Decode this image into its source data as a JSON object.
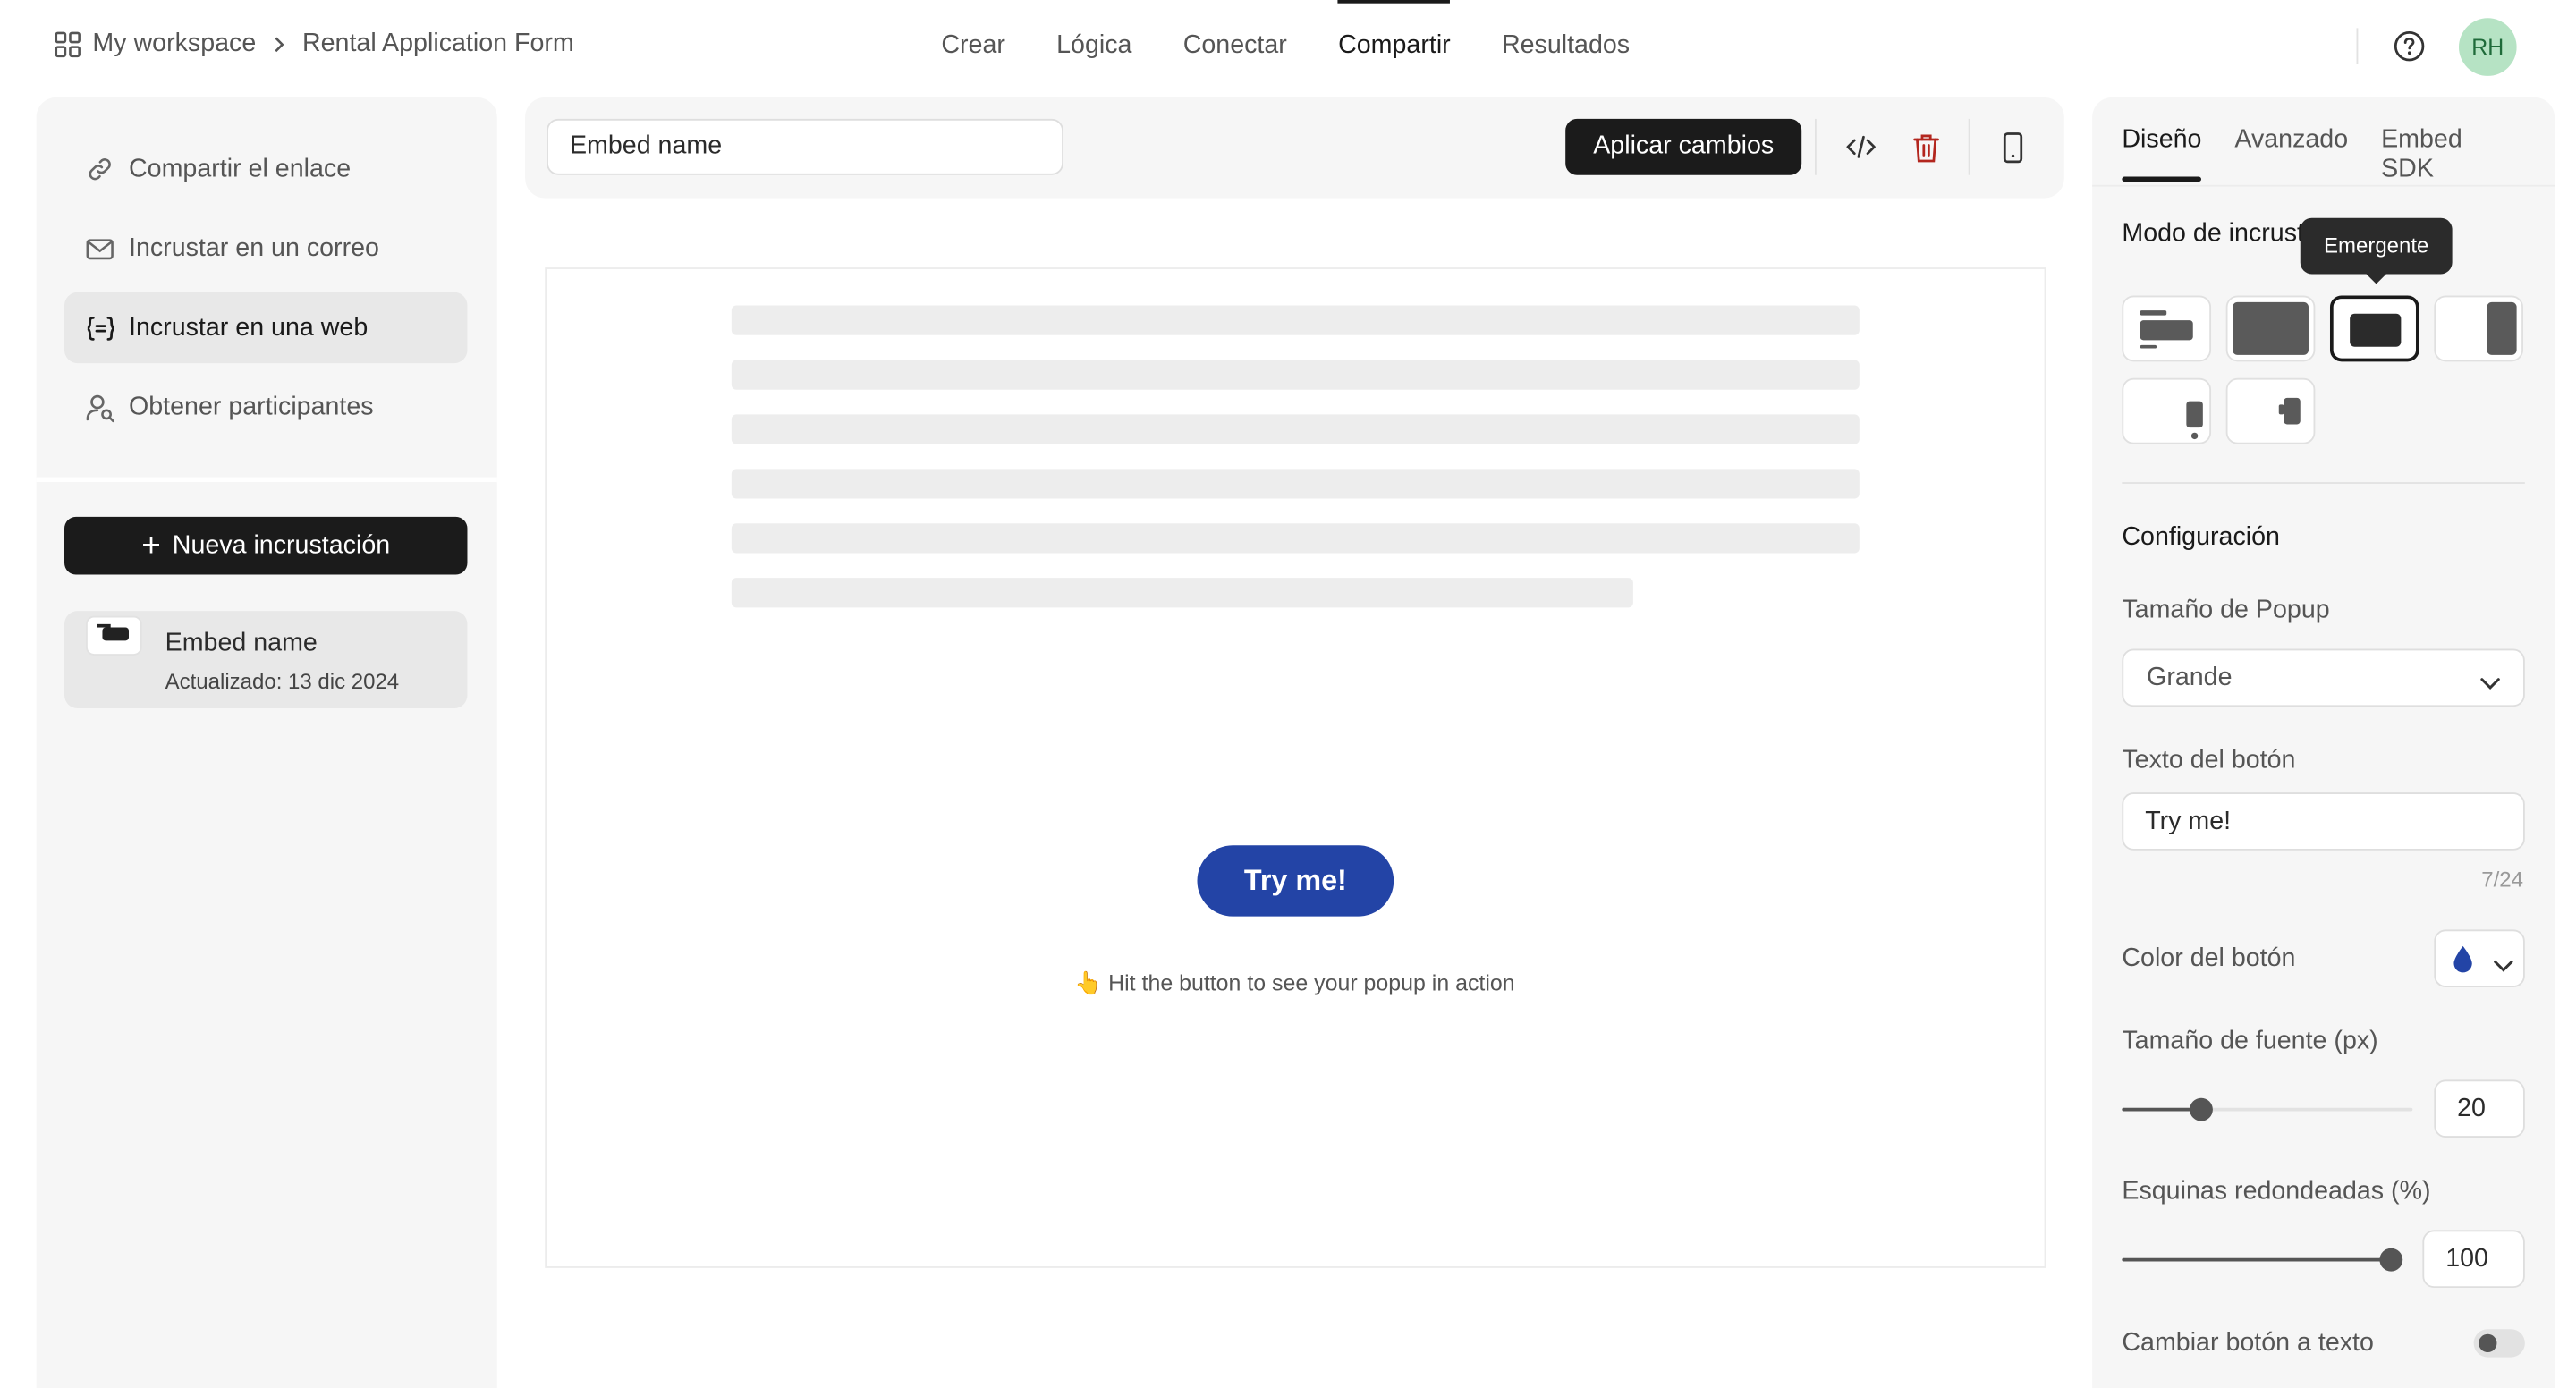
{
  "breadcrumb": {
    "workspace": "My workspace",
    "form": "Rental Application Form"
  },
  "tabs": [
    {
      "label": "Crear"
    },
    {
      "label": "Lógica"
    },
    {
      "label": "Conectar"
    },
    {
      "label": "Compartir",
      "active": true
    },
    {
      "label": "Resultados"
    }
  ],
  "user": {
    "initials": "RH"
  },
  "share_nav": [
    {
      "label": "Compartir el enlace",
      "icon": "link-icon"
    },
    {
      "label": "Incrustar en un correo",
      "icon": "mail-icon"
    },
    {
      "label": "Incrustar en una web",
      "icon": "code-braces-icon",
      "active": true
    },
    {
      "label": "Obtener participantes",
      "icon": "user-search-icon"
    }
  ],
  "new_embed_label": "Nueva incrustación",
  "embed_item": {
    "name": "Embed name",
    "updated": "Actualizado: 13 dic 2024"
  },
  "toolbar": {
    "name_value": "Embed name",
    "apply_label": "Aplicar cambios"
  },
  "preview": {
    "button_label": "Try me!",
    "hint": "👆 Hit the button to see your popup in action"
  },
  "panel": {
    "tabs": [
      {
        "label": "Diseño",
        "active": true
      },
      {
        "label": "Avanzado"
      },
      {
        "label": "Embed SDK"
      }
    ],
    "mode_title": "Modo de incrustación",
    "mode_tooltip": "Emergente",
    "config_title": "Configuración",
    "popup_size_label": "Tamaño de Popup",
    "popup_size_value": "Grande",
    "button_text_label": "Texto del botón",
    "button_text_value": "Try me!",
    "button_text_counter": "7/24",
    "button_color_label": "Color del botón",
    "button_color": "#2344a6",
    "font_size_label": "Tamaño de fuente (px)",
    "font_size_value": "20",
    "font_size_fraction": 0.25,
    "corners_label": "Esquinas redondeadas (%)",
    "corners_value": "100",
    "corners_fraction": 1.0,
    "text_toggle_label": "Cambiar botón a texto",
    "text_toggle_on": false
  }
}
